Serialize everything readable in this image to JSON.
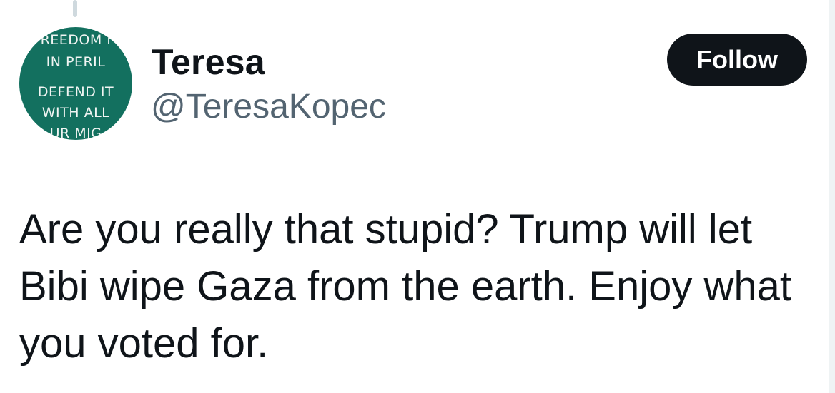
{
  "author": {
    "display_name": "Teresa",
    "handle": "@TeresaKopec",
    "avatar": {
      "lines": [
        "REEDOM I",
        "IN PERIL",
        "DEFEND IT",
        "WITH ALL",
        "UR MIG"
      ],
      "background_color": "#13705f"
    }
  },
  "follow_button": {
    "label": "Follow"
  },
  "tweet": {
    "lines": [
      "Are you really that stupid? Trump will let",
      "Bibi wipe Gaza from the earth. Enjoy what",
      "you voted for."
    ]
  }
}
